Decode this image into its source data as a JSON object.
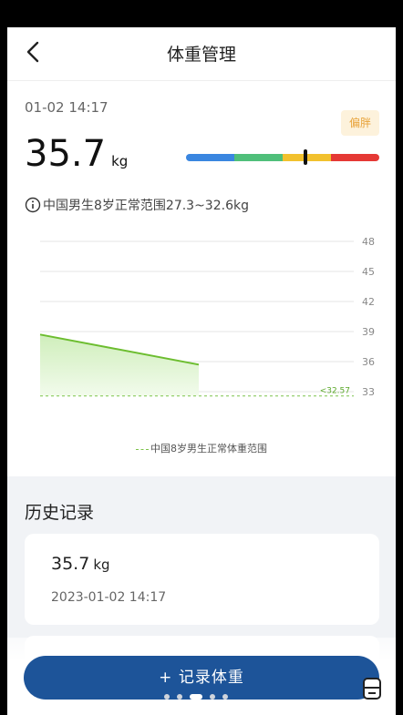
{
  "nav": {
    "title": "体重管理"
  },
  "measurement": {
    "datetime": "01-02 14:17",
    "weight": "35.7",
    "unit": "kg",
    "status_badge": "偏胖",
    "scale_colors": [
      "#3a86e0",
      "#4fbf7a",
      "#f2c12e",
      "#e53935"
    ],
    "marker_fraction": 0.62
  },
  "info": {
    "text": "中国男生8岁正常范围27.3~32.6kg"
  },
  "chart_data": {
    "type": "line",
    "y_ticks": [
      48,
      45,
      42,
      39,
      36,
      33
    ],
    "ylim": [
      33,
      48
    ],
    "series": [
      {
        "values": [
          38.7,
          35.7
        ],
        "color": "#6cbd2f"
      }
    ],
    "reference_line": {
      "value": 32.57,
      "label": "<32.57",
      "color": "#7cc34a"
    },
    "legend": "中国8岁男生正常体重范围",
    "grid": true
  },
  "history": {
    "title": "历史记录",
    "records": [
      {
        "weight": "35.7",
        "unit": "kg",
        "date": "2023-01-02 14:17"
      }
    ]
  },
  "actions": {
    "record_label": "+ 记录体重"
  }
}
